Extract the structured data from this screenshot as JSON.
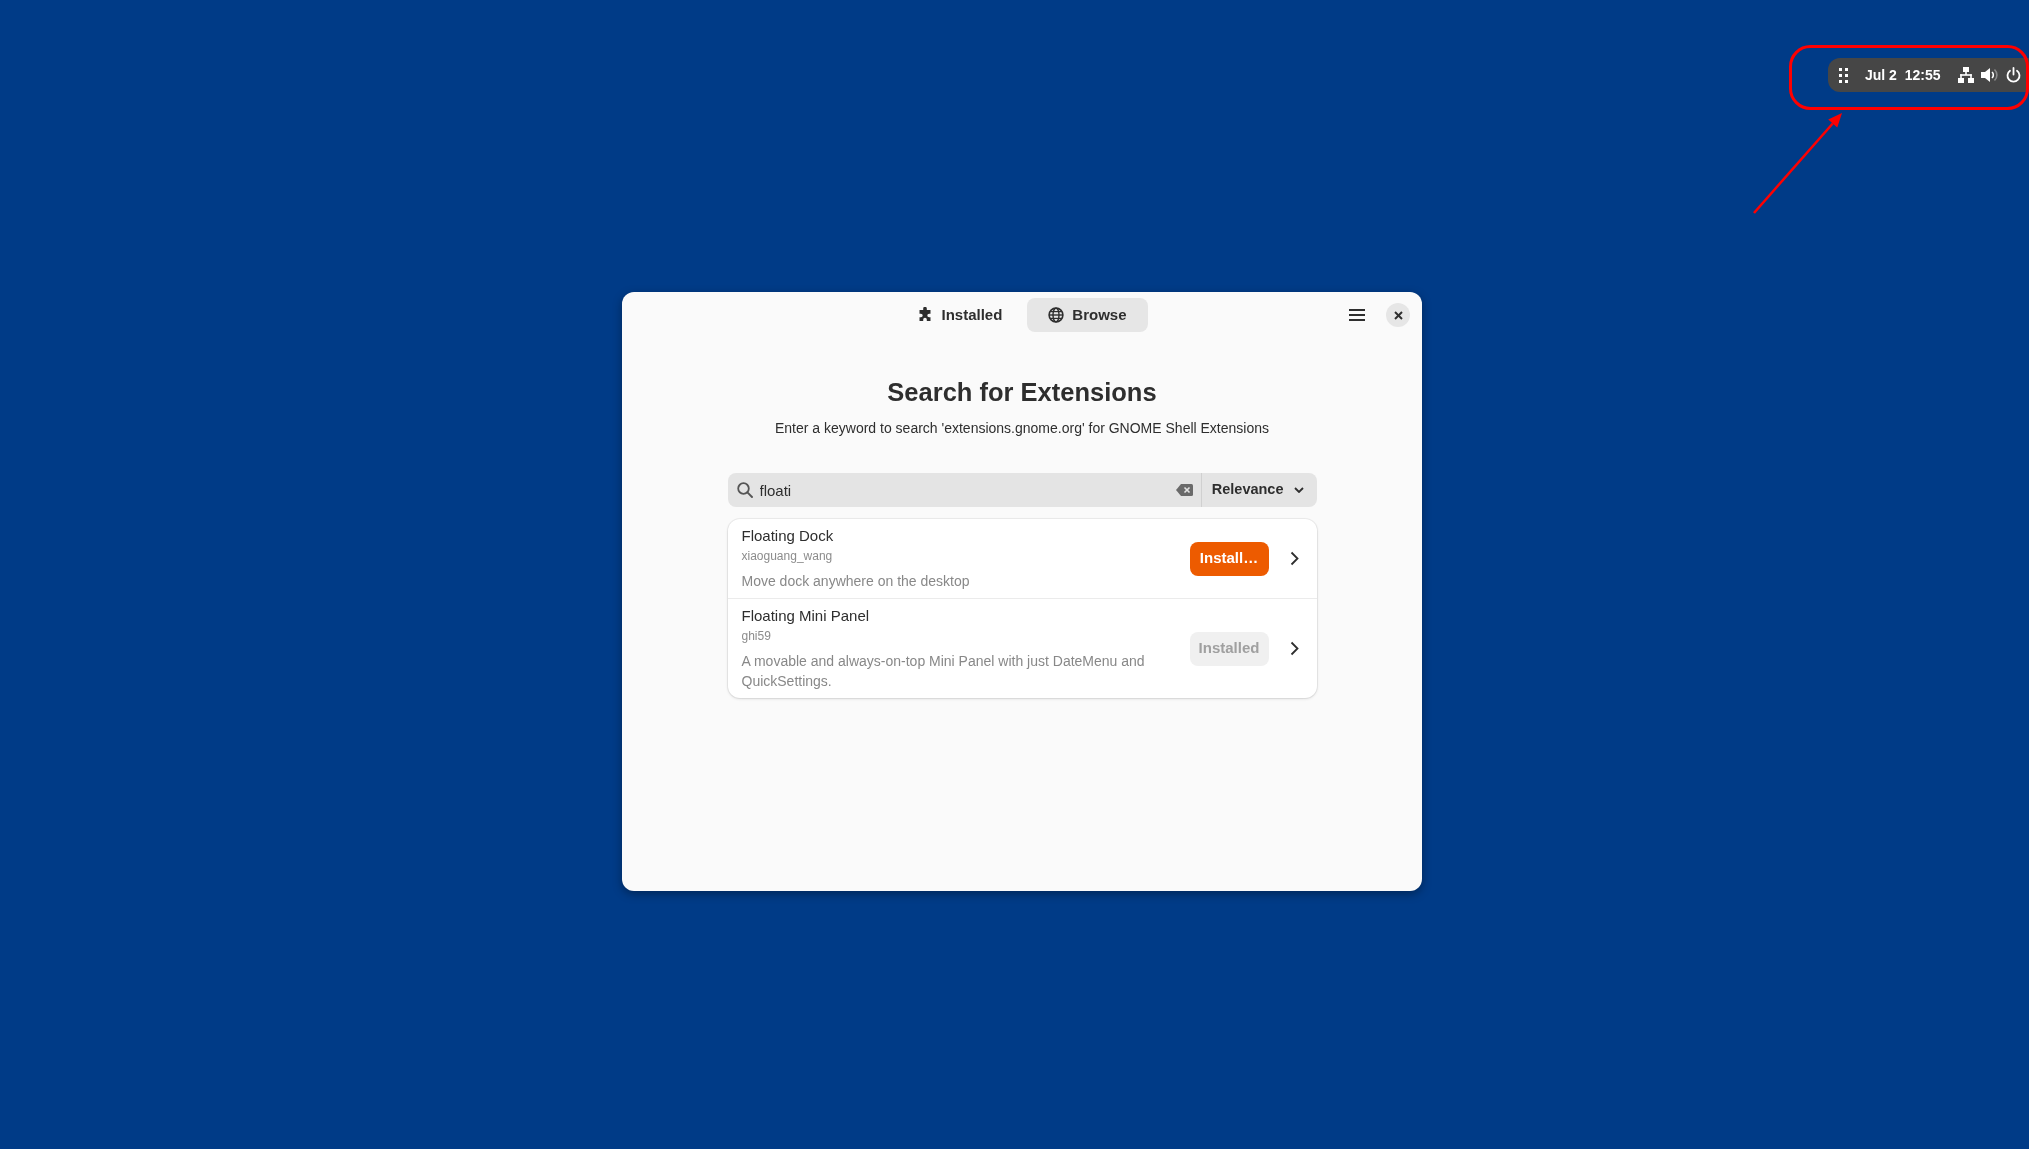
{
  "top_panel": {
    "clock": "Jul 2  12:55"
  },
  "annotations": [
    {
      "kind": "outline"
    },
    {
      "kind": "arrow"
    }
  ],
  "window": {
    "tabs": [
      {
        "label": "Installed",
        "selected": false
      },
      {
        "label": "Browse",
        "selected": true
      }
    ],
    "heading": "Search for Extensions",
    "subheading": "Enter a keyword to search 'extensions.gnome.org' for GNOME Shell Extensions",
    "search": {
      "value": "floati"
    },
    "sort": {
      "label": "Relevance"
    },
    "results": [
      {
        "name": "Floating Dock",
        "author": "xiaoguang_wang",
        "description": "Move dock anywhere on the desktop",
        "action": {
          "label": "Install…",
          "disabled": false
        }
      },
      {
        "name": "Floating Mini Panel",
        "author": "ghi59",
        "description": "A movable and always-on-top Mini Panel with just DateMenu and QuickSettings.",
        "action": {
          "label": "Installed",
          "disabled": true
        }
      }
    ]
  }
}
